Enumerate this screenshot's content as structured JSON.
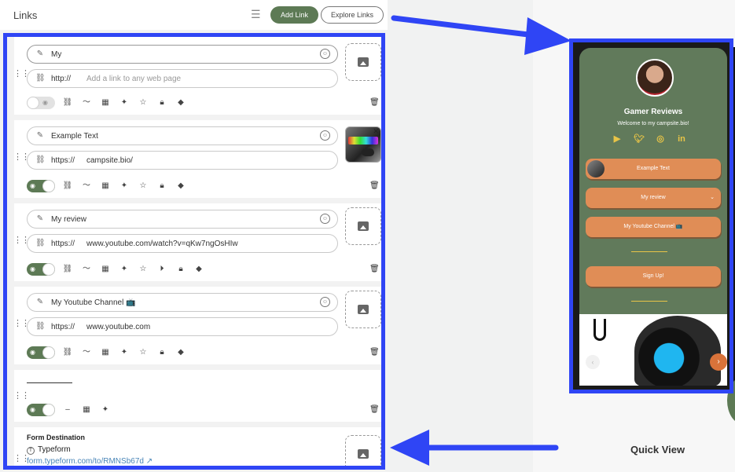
{
  "header": {
    "title": "Links",
    "add_link": "Add Link",
    "explore_links": "Explore Links"
  },
  "cards": [
    {
      "title_value": "My",
      "url_prefix": "http://",
      "url_value": "",
      "url_placeholder": "Add a link to any web page",
      "visible": false
    },
    {
      "title_value": "Example Text",
      "url_prefix": "https://",
      "url_value": "campsite.bio/",
      "visible": true
    },
    {
      "title_value": "My review",
      "url_prefix": "https://",
      "url_value": "www.youtube.com/watch?v=qKw7ngOsHIw",
      "visible": true
    },
    {
      "title_value": "My Youtube Channel 📺",
      "url_prefix": "https://",
      "url_value": "www.youtube.com",
      "visible": true
    }
  ],
  "form_card": {
    "label": "Form Destination",
    "provider": "Typeform",
    "url": "form.typeform.com/to/RMNSb67d"
  },
  "preview": {
    "name": "Gamer Reviews",
    "bio": "Welcome to my campsite.bio!",
    "buttons": [
      "Example Text",
      "My review",
      "My Youtube Channel 📺",
      "Sign Up!"
    ],
    "quick_view": "Quick View"
  },
  "colors": {
    "accent_green": "#5d7a55",
    "highlight_blue": "#2f45f5",
    "button_orange": "#e08d56",
    "social_yellow": "#e8c447"
  }
}
